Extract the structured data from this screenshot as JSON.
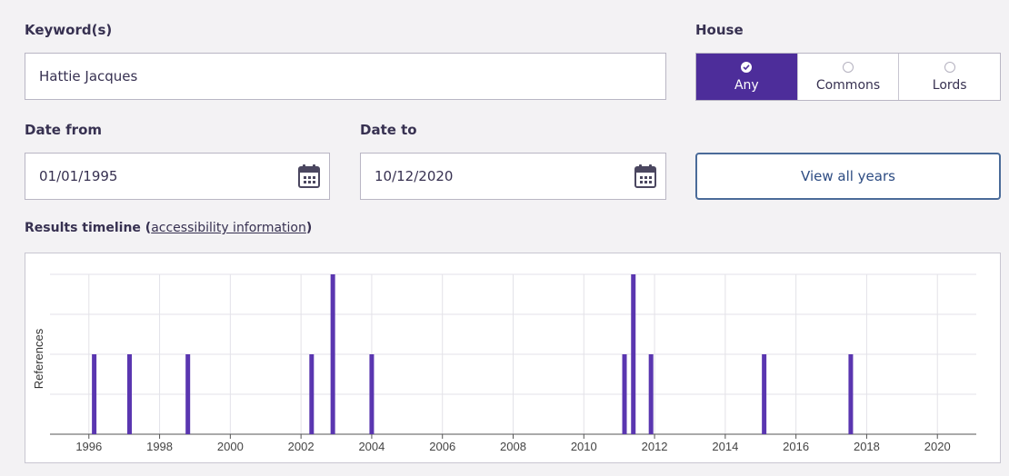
{
  "keyword": {
    "label": "Keyword(s)",
    "value": "Hattie Jacques"
  },
  "house": {
    "label": "House",
    "options": [
      {
        "label": "Any",
        "selected": true
      },
      {
        "label": "Commons",
        "selected": false
      },
      {
        "label": "Lords",
        "selected": false
      }
    ]
  },
  "date_from": {
    "label": "Date from",
    "value": "01/01/1995"
  },
  "date_to": {
    "label": "Date to",
    "value": "10/12/2020"
  },
  "view_all_label": "View all years",
  "timeline": {
    "label": "Results timeline",
    "link": "accessibility information"
  },
  "colors": {
    "accent": "#4d2d9a",
    "bar": "#5a36b0",
    "button_border": "#4a6b99"
  },
  "chart_data": {
    "type": "bar",
    "ylabel": "References",
    "xlabel": "",
    "x_ticks": [
      "1996",
      "1998",
      "2000",
      "2002",
      "2004",
      "2006",
      "2008",
      "2010",
      "2012",
      "2014",
      "2016",
      "2018",
      "2020"
    ],
    "xlim": [
      1994.9,
      2021.1
    ],
    "ylim": [
      0,
      2
    ],
    "grid": true,
    "bars": [
      {
        "x": 1996.15,
        "value": 1
      },
      {
        "x": 1997.15,
        "value": 1
      },
      {
        "x": 1998.8,
        "value": 1
      },
      {
        "x": 2002.3,
        "value": 1
      },
      {
        "x": 2002.9,
        "value": 2
      },
      {
        "x": 2004.0,
        "value": 1
      },
      {
        "x": 2011.15,
        "value": 1
      },
      {
        "x": 2011.4,
        "value": 2
      },
      {
        "x": 2011.9,
        "value": 1
      },
      {
        "x": 2015.1,
        "value": 1
      },
      {
        "x": 2017.55,
        "value": 1
      }
    ]
  }
}
